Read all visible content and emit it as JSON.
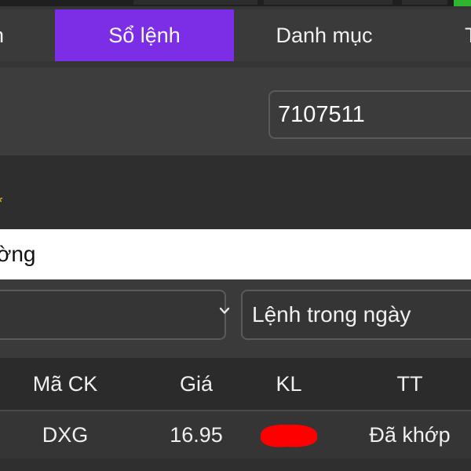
{
  "tabs": [
    {
      "label": "h",
      "active": false
    },
    {
      "label": "Sổ lệnh",
      "active": true
    },
    {
      "label": "Danh mục",
      "active": false
    },
    {
      "label": "T",
      "active": false
    }
  ],
  "account": {
    "value": "7107511"
  },
  "required_marker": "*",
  "market_input": {
    "text": "ờng"
  },
  "filters": {
    "left_select": {
      "value": ""
    },
    "right_select": {
      "value": "Lệnh trong ngày"
    }
  },
  "table": {
    "columns": [
      "Mã CK",
      "Giá",
      "KL",
      "TT"
    ],
    "rows": [
      {
        "ma_ck": "DXG",
        "gia": "16.95",
        "kl": "",
        "tt": "Đã khớp"
      }
    ]
  },
  "colors": {
    "accent": "#7b2ee6",
    "background": "#353535",
    "required": "#e8b21f",
    "redaction": "#ff0000",
    "status_green": "#2fb52f"
  },
  "icons": {
    "select_arrow": "chevron-down-icon"
  }
}
